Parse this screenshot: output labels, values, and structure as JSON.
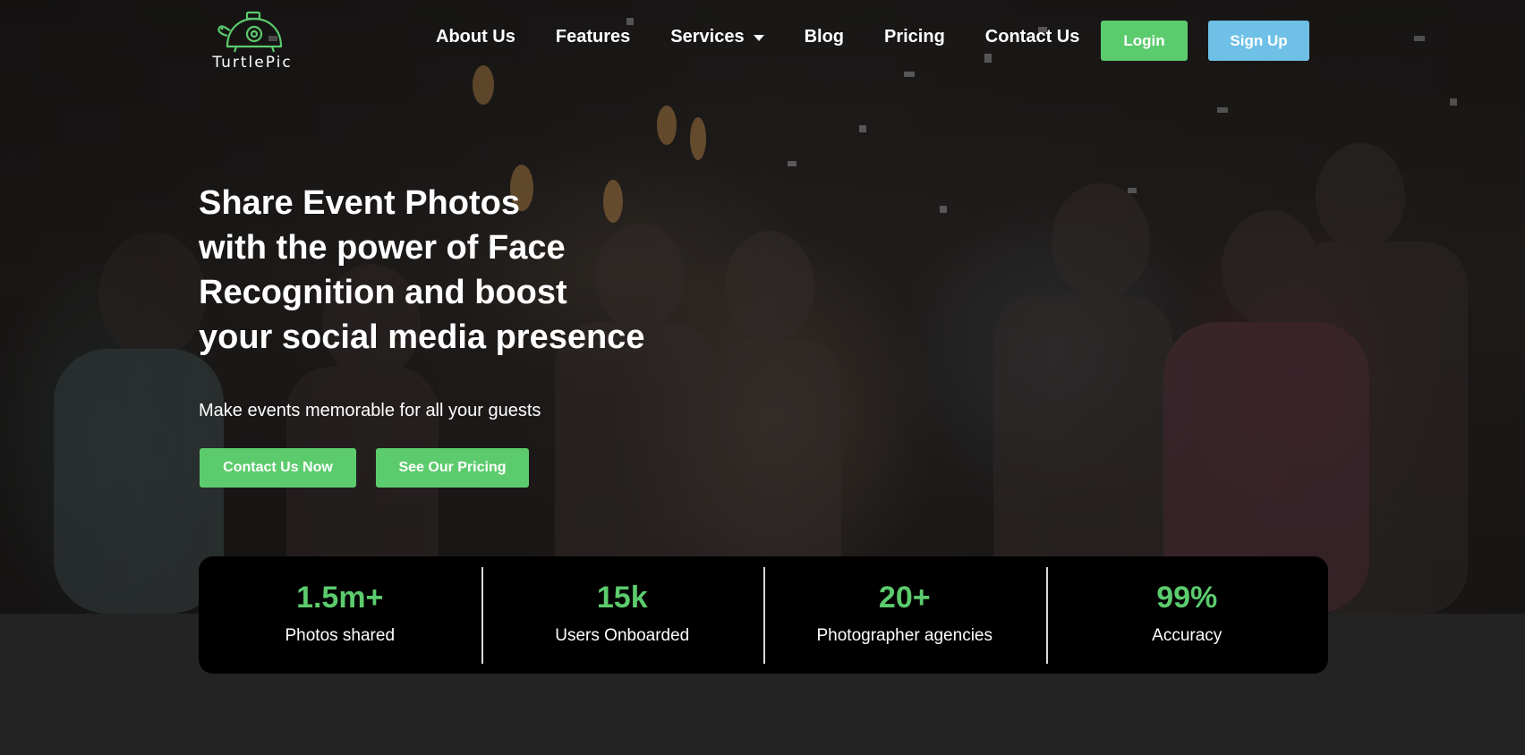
{
  "brand": {
    "name": "TurtlePic",
    "logo_icon": "turtle-camera-icon",
    "logo_color": "#5ccb6d"
  },
  "nav": {
    "items": [
      {
        "label": "About Us"
      },
      {
        "label": "Features"
      },
      {
        "label": "Services",
        "icon": "caret-down-icon"
      },
      {
        "label": "Blog"
      },
      {
        "label": "Pricing"
      },
      {
        "label": "Contact Us"
      }
    ],
    "login_label": "Login",
    "signup_label": "Sign Up"
  },
  "hero": {
    "headline_lines": [
      "Share Event Photos",
      "with the power of Face",
      "Recognition and boost",
      "your social media presence"
    ],
    "subheadline": "Make events memorable for all your guests",
    "cta_contact": "Contact Us Now",
    "cta_pricing": "See Our Pricing"
  },
  "stats": [
    {
      "value": "1.5m+",
      "label": "Photos shared"
    },
    {
      "value": "15k",
      "label": "Users Onboarded"
    },
    {
      "value": "20+",
      "label": "Photographer agencies"
    },
    {
      "value": "99%",
      "label": "Accuracy"
    }
  ],
  "colors": {
    "accent_green": "#5ccb6d",
    "signup_blue": "#6fc0e6",
    "stats_background": "#000000",
    "page_background": "#232323"
  }
}
